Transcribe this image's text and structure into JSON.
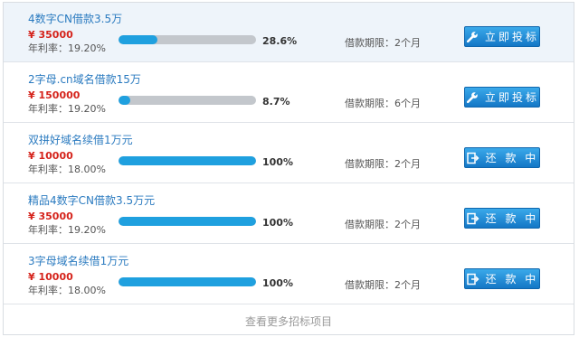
{
  "loans": [
    {
      "title": "4数字CN借款3.5万",
      "amount": "¥ 35000",
      "rate": "年利率：19.20%",
      "progress": 0.286,
      "percent": "28.6%",
      "period": "借款期限：2个月",
      "button": "立即投标",
      "button_icon": "wrench-icon",
      "highlighted": true
    },
    {
      "title": "2字母.cn域名借款15万",
      "amount": "¥ 150000",
      "rate": "年利率：19.20%",
      "progress": 0.087,
      "percent": "8.7%",
      "period": "借款期限：6个月",
      "button": "立即投标",
      "button_icon": "wrench-icon",
      "highlighted": false
    },
    {
      "title": "双拼好域名续借1万元",
      "amount": "¥ 10000",
      "rate": "年利率：18.00%",
      "progress": 1.0,
      "percent": "100%",
      "period": "借款期限：2个月",
      "button": "还 款 中",
      "button_icon": "exit-icon",
      "highlighted": false
    },
    {
      "title": "精品4数字CN借款3.5万元",
      "amount": "¥ 35000",
      "rate": "年利率：19.20%",
      "progress": 1.0,
      "percent": "100%",
      "period": "借款期限：2个月",
      "button": "还 款 中",
      "button_icon": "exit-icon",
      "highlighted": false
    },
    {
      "title": "3字母域名续借1万元",
      "amount": "¥ 10000",
      "rate": "年利率：18.00%",
      "progress": 1.0,
      "percent": "100%",
      "period": "借款期限：2个月",
      "button": "还 款 中",
      "button_icon": "exit-icon",
      "highlighted": false
    }
  ],
  "more_link": "查看更多招标项目",
  "colors": {
    "accent": "#1fa0df",
    "amount": "#d5231b",
    "title": "#2b7bc0",
    "track": "#c3c7cc"
  }
}
